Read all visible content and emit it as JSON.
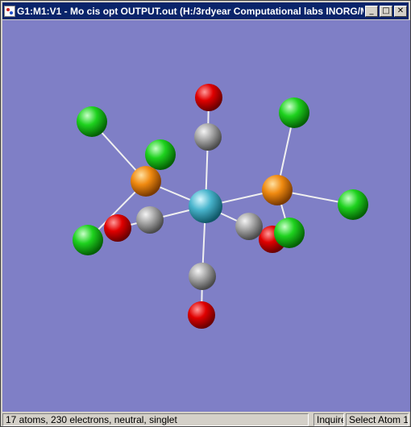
{
  "window": {
    "title": "G1:M1:V1 - Mo cis opt OUTPUT.out (H:/3rdyear Computational labs INORG/M...",
    "buttons": {
      "minimize": "_",
      "maximize": "□",
      "close": "✕"
    }
  },
  "viewport": {
    "background": "#7f7fc6"
  },
  "status": {
    "summary": "17 atoms, 230 electrons, neutral, singlet",
    "mode": "Inquire",
    "action": "Select Atom 1"
  },
  "colors": {
    "carbon": "#9a9a9a",
    "oxygen": "#dd0d0d",
    "chlorine": "#18d018",
    "phosphorus": "#ee8410",
    "molybdenum": "#4ab4cc",
    "bond": "#f2f2f2"
  }
}
